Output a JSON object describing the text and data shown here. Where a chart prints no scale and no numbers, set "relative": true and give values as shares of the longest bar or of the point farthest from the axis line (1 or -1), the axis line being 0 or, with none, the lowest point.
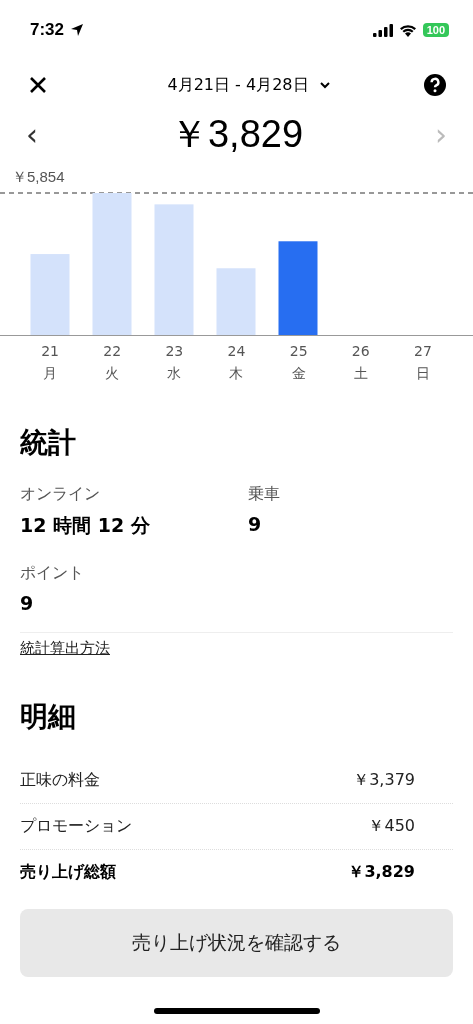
{
  "status_bar": {
    "time": "7:32",
    "battery": "100"
  },
  "header": {
    "date_range": "4月21日 - 4月28日",
    "prev_enabled": true,
    "next_enabled": false,
    "prev": "‹",
    "next": "›"
  },
  "total": "￥3,829",
  "chart": {
    "chart_data": {
      "type": "bar",
      "categories": [
        "21",
        "22",
        "23",
        "24",
        "25",
        "26",
        "27"
      ],
      "values": [
        0.57,
        1.0,
        0.92,
        0.47,
        0.66,
        0,
        0
      ],
      "relative": true,
      "annotations": [
        "￥5,854"
      ]
    },
    "days": [
      {
        "weekday": "月",
        "selected": false
      },
      {
        "weekday": "火",
        "selected": false
      },
      {
        "weekday": "水",
        "selected": false
      },
      {
        "weekday": "木",
        "selected": false
      },
      {
        "weekday": "金",
        "selected": true
      },
      {
        "weekday": "土",
        "selected": false
      },
      {
        "weekday": "日",
        "selected": false
      }
    ]
  },
  "stats": {
    "title": "統計",
    "items": [
      {
        "label": "オンライン",
        "value": "12 時間 12 分"
      },
      {
        "label": "乗車",
        "value": "9"
      },
      {
        "label": "ポイント",
        "value": "9"
      }
    ],
    "link": "統計算出方法"
  },
  "breakdown": {
    "title": "明細",
    "rows": [
      {
        "kind": "item",
        "label": "正味の料金",
        "amount": "￥3,379"
      },
      {
        "kind": "item",
        "label": "プロモーション",
        "amount": "￥450"
      },
      {
        "kind": "total",
        "label": "売り上げ総額",
        "amount": "￥3,829"
      }
    ]
  },
  "button": "売り上げ状況を確認する"
}
